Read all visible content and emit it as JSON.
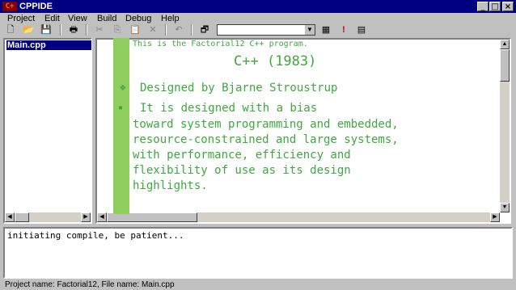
{
  "window": {
    "title": "CPPIDE",
    "icon": "cpp-app-icon"
  },
  "window_controls": {
    "minimize": "_",
    "maximize": "□",
    "close": "×"
  },
  "menu": [
    {
      "label": "Project"
    },
    {
      "label": "Edit"
    },
    {
      "label": "View"
    },
    {
      "label": "Build"
    },
    {
      "label": "Debug"
    },
    {
      "label": "Help"
    }
  ],
  "toolbar": {
    "icons": [
      "new-file-icon",
      "open-folder-icon",
      "save-icon",
      "print-icon",
      "cut-icon",
      "copy-icon",
      "paste-icon",
      "delete-icon",
      "undo-icon",
      "properties-icon",
      "build-icon",
      "stop-icon",
      "run-icon"
    ],
    "combo_value": ""
  },
  "file_list": {
    "items": [
      "Main.cpp"
    ],
    "selected": 0
  },
  "editor": {
    "header_line": "This is the Factorial12 C++ program.",
    "title_line": "C++ (1983)",
    "bullet1_symbol": "❖",
    "bullet1_text": "Designed by Bjarne Stroustrup",
    "bullet2_symbol": "▪",
    "bullet2_lines": [
      "It is designed with a bias",
      "toward system programming and embedded,",
      "resource-constrained and large systems,",
      "with performance, efficiency and",
      "flexibility of use as its design",
      "highlights."
    ]
  },
  "output": {
    "text": "initiating compile, be patient..."
  },
  "status": {
    "text": "Project name: Factorial12, File name: Main.cpp"
  },
  "colors": {
    "title_bar": "#000080",
    "code_text": "#3fa83f",
    "gutter": "#8fcf5f",
    "selection": "#000080"
  }
}
